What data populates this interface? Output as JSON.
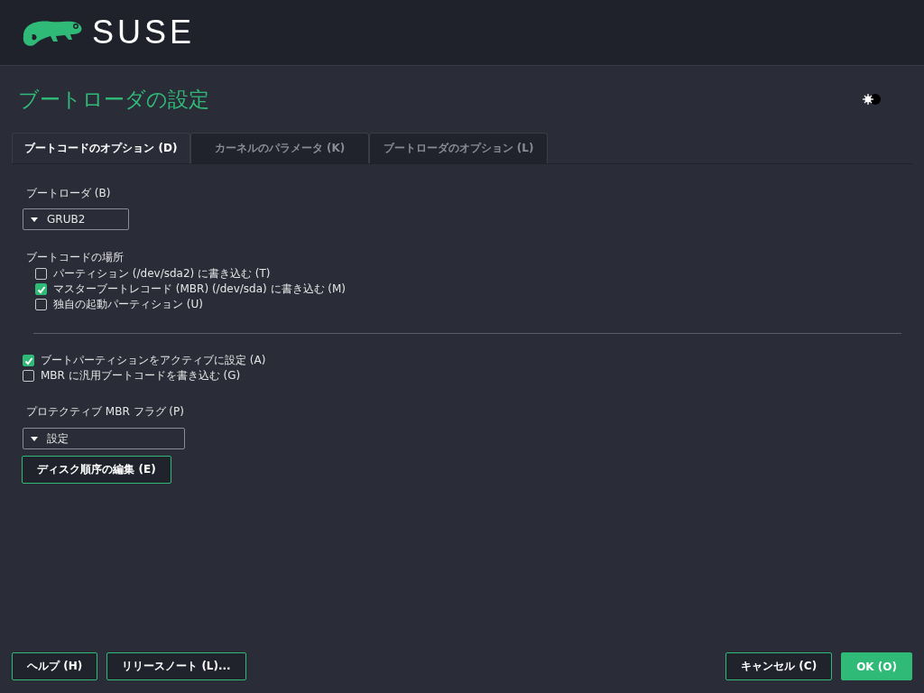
{
  "header": {
    "logo_text": "SUSE"
  },
  "title": "ブートローダの設定",
  "tabs": [
    {
      "label": "ブートコードのオプション (D)",
      "selected": true
    },
    {
      "label": "カーネルのパラメータ (K)",
      "selected": false
    },
    {
      "label": "ブートローダのオプション (L)",
      "selected": false
    }
  ],
  "bootloader": {
    "label": "ブートローダ (B)",
    "value": "GRUB2"
  },
  "boot_code_location": {
    "label": "ブートコードの場所",
    "options": [
      {
        "label": "パーティション (/dev/sda2) に書き込む (T)",
        "checked": false
      },
      {
        "label": "マスターブートレコード (MBR) (/dev/sda) に書き込む (M)",
        "checked": true
      },
      {
        "label": "独自の起動パーティション (U)",
        "checked": false
      }
    ]
  },
  "options": [
    {
      "label": "ブートパーティションをアクティブに設定 (A)",
      "checked": true
    },
    {
      "label": "MBR に汎用ブートコードを書き込む (G)",
      "checked": false
    }
  ],
  "protective_mbr": {
    "label": "プロテクティブ MBR フラグ (P)",
    "value": "設定"
  },
  "edit_disk_order_button": "ディスク順序の編集 (E)",
  "footer": {
    "left": [
      {
        "label": "ヘルプ (H)",
        "kind": "outline"
      },
      {
        "label": "リリースノート (L)...",
        "kind": "outline"
      }
    ],
    "right": [
      {
        "label": "キャンセル (C)",
        "kind": "outline"
      },
      {
        "label": "OK (O)",
        "kind": "primary"
      }
    ]
  }
}
